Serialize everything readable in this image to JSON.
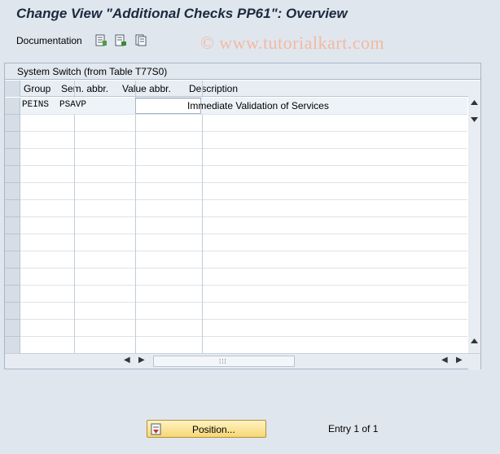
{
  "title": "Change View \"Additional Checks PP61\": Overview",
  "toolbar": {
    "documentation_label": "Documentation",
    "icons": [
      "detail-view-icon",
      "new-entries-icon",
      "copy-as-icon"
    ]
  },
  "watermark": "© www.tutorialkart.com",
  "panel": {
    "title": "System Switch (from Table T77S0)"
  },
  "table": {
    "columns": [
      "Group",
      "Sem. abbr.",
      "Value abbr.",
      "Description"
    ],
    "rows": [
      {
        "group": "PEINS",
        "sem": "PSAVP",
        "value": "",
        "description": "Immediate Validation of Services"
      }
    ]
  },
  "footer": {
    "position_label": "Position...",
    "entry_info": "Entry 1 of 1"
  },
  "colors": {
    "background": "#dfe6ee",
    "title": "#1a2a3e",
    "position_button": "#f7d774"
  }
}
